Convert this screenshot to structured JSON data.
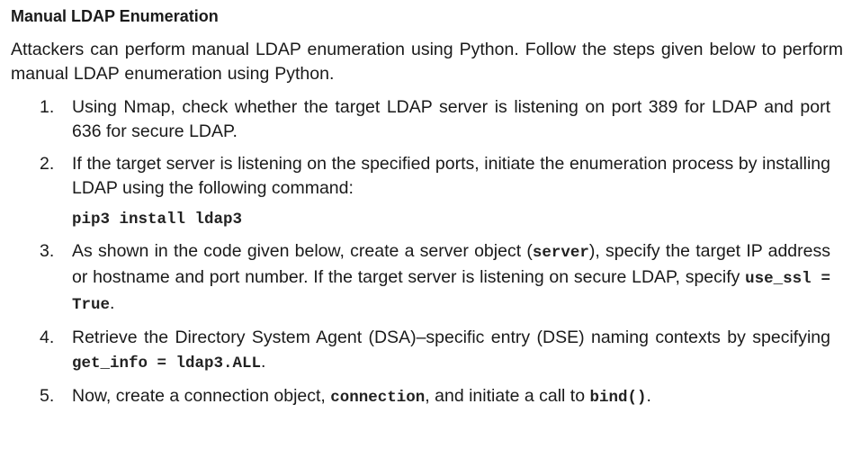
{
  "section": {
    "title": "Manual LDAP Enumeration",
    "intro": "Attackers can perform manual LDAP enumeration using Python. Follow the steps given below to perform manual LDAP enumeration using Python."
  },
  "steps": [
    {
      "number": "1.",
      "text": "Using Nmap, check whether the target LDAP server is listening on port 389 for LDAP and port 636 for secure LDAP."
    },
    {
      "number": "2.",
      "text": "If the target server is listening on the specified ports, initiate the enumeration process by installing LDAP using the following command:",
      "command": "pip3 install ldap3"
    },
    {
      "number": "3.",
      "text_a": "As shown in the code given below, create a server object (",
      "code_a": "server",
      "text_b": "), specify the target IP address or hostname and port number. If the target server is listening on secure LDAP, specify ",
      "code_b": "use_ssl = True",
      "text_c": "."
    },
    {
      "number": "4.",
      "text_a": "Retrieve the Directory System Agent (DSA)–specific entry (DSE) naming contexts by specifying ",
      "code_a": "get_info = ldap3.ALL",
      "text_b": "."
    },
    {
      "number": "5.",
      "text_a": "Now, create a connection object, ",
      "code_a": "connection",
      "text_b": ", and initiate a call to ",
      "code_b": "bind()",
      "text_c": "."
    }
  ]
}
